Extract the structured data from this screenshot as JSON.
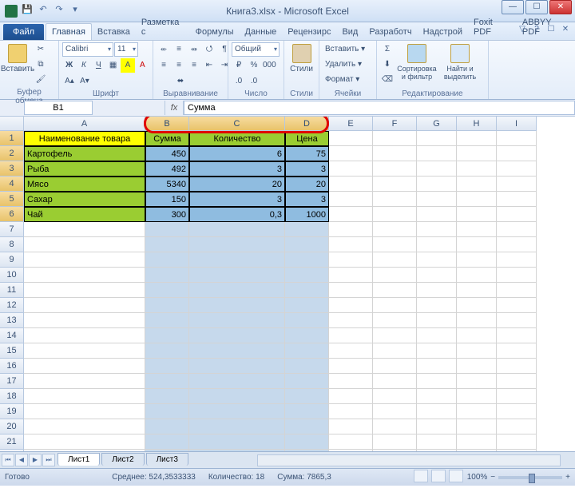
{
  "title": "Книга3.xlsx - Microsoft Excel",
  "tabs": {
    "file": "Файл",
    "list": [
      "Главная",
      "Вставка",
      "Разметка с",
      "Формулы",
      "Данные",
      "Рецензирс",
      "Вид",
      "Разработч",
      "Надстрой",
      "Foxit PDF",
      "ABBYY PDF"
    ],
    "active": 0
  },
  "ribbon": {
    "clipboard": {
      "label": "Буфер обмена",
      "paste": "Вставить"
    },
    "font": {
      "label": "Шрифт",
      "name": "Calibri",
      "size": "11"
    },
    "align": {
      "label": "Выравнивание"
    },
    "number": {
      "label": "Число",
      "format": "Общий"
    },
    "styles": {
      "label": "Стили",
      "btn": "Стили"
    },
    "cells": {
      "label": "Ячейки",
      "insert": "Вставить ▾",
      "delete": "Удалить ▾",
      "format": "Формат ▾"
    },
    "editing": {
      "label": "Редактирование",
      "sort": "Сортировка и фильтр",
      "find": "Найти и выделить"
    }
  },
  "namebox": "B1",
  "formula": "Сумма",
  "cols": {
    "letters": [
      "A",
      "B",
      "C",
      "D",
      "E",
      "F",
      "G",
      "H",
      "I"
    ],
    "widths": [
      152,
      55,
      120,
      55,
      55,
      55,
      50,
      50,
      50
    ],
    "selected": [
      1,
      2,
      3
    ]
  },
  "rows": 22,
  "data": {
    "headers": [
      "Наименование товара",
      "Сумма",
      "Количество",
      "Цена"
    ],
    "rows": [
      [
        "Картофель",
        "450",
        "6",
        "75"
      ],
      [
        "Рыба",
        "492",
        "3",
        "3"
      ],
      [
        "Мясо",
        "5340",
        "20",
        "20"
      ],
      [
        "Сахар",
        "150",
        "3",
        "3"
      ],
      [
        "Чай",
        "300",
        "0,3",
        "1000"
      ]
    ]
  },
  "sheets": [
    "Лист1",
    "Лист2",
    "Лист3"
  ],
  "status": {
    "ready": "Готово",
    "avg_label": "Среднее:",
    "avg": "524,3533333",
    "count_label": "Количество:",
    "count": "18",
    "sum_label": "Сумма:",
    "sum": "7865,3",
    "zoom": "100%"
  }
}
